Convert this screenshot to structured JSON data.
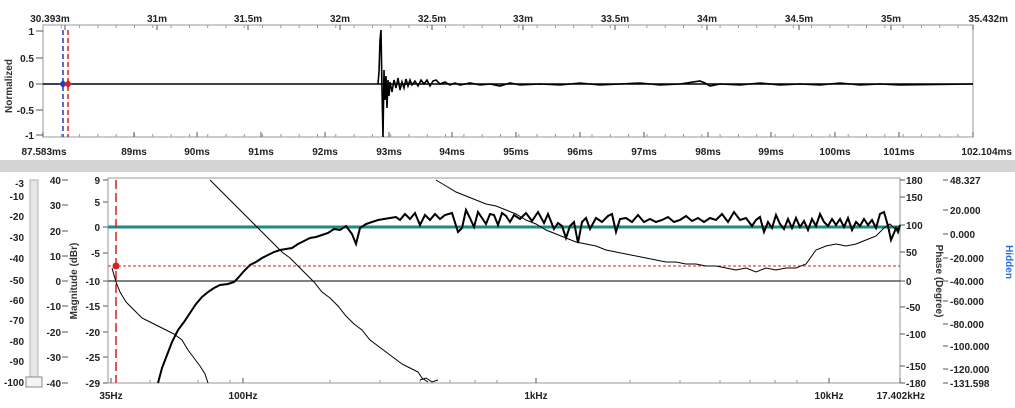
{
  "top_plot": {
    "distance_ticks": [
      "30.393m",
      "31m",
      "31.5m",
      "32m",
      "32.5m",
      "33m",
      "33.5m",
      "34m",
      "34.5m",
      "35m",
      "35.432m"
    ],
    "time_ticks": [
      "87.583ms",
      "89ms",
      "90ms",
      "91ms",
      "92ms",
      "93ms",
      "94ms",
      "95ms",
      "96ms",
      "97ms",
      "98ms",
      "99ms",
      "100ms",
      "101ms",
      "102.104ms"
    ],
    "y_ticks": [
      "1",
      "0.5",
      "0",
      "-0.5",
      "-1"
    ],
    "y_label": "Normalized"
  },
  "bottom_plot": {
    "slider_ticks": [
      "-3",
      "-10",
      "-20",
      "-30",
      "-40",
      "-50",
      "-60",
      "-70",
      "-80",
      "-90",
      "-100"
    ],
    "outer_left_ticks": [
      "40",
      "30",
      "20",
      "10",
      "0",
      "-10",
      "-20",
      "-30",
      "-40"
    ],
    "inner_left_ticks": [
      "9",
      "5",
      "0",
      "-5",
      "-10",
      "-15",
      "-20",
      "-25",
      "-29"
    ],
    "y_label": "Magnitude (dBr)",
    "phase_ticks": [
      "180",
      "150",
      "100",
      "50",
      "0",
      "-50",
      "-100",
      "-150",
      "-180"
    ],
    "phase_label": "Phase (Degree)",
    "far_right_ticks": [
      "48.327",
      "20.000",
      "0.000",
      "-20.000",
      "-40.000",
      "-60.000",
      "-80.000",
      "-100.000",
      "-120.000",
      "-131.598"
    ],
    "far_right_label": "Hidden",
    "x_ticks": [
      "35Hz",
      "100Hz",
      "1kHz",
      "10kHz",
      "17.402kHz"
    ]
  },
  "colors": {
    "accent_teal": "#1a8a8a",
    "cursor_red": "#d62020",
    "cursor_blue": "#1f3fbf",
    "hidden_label": "#2a6fd6"
  }
}
